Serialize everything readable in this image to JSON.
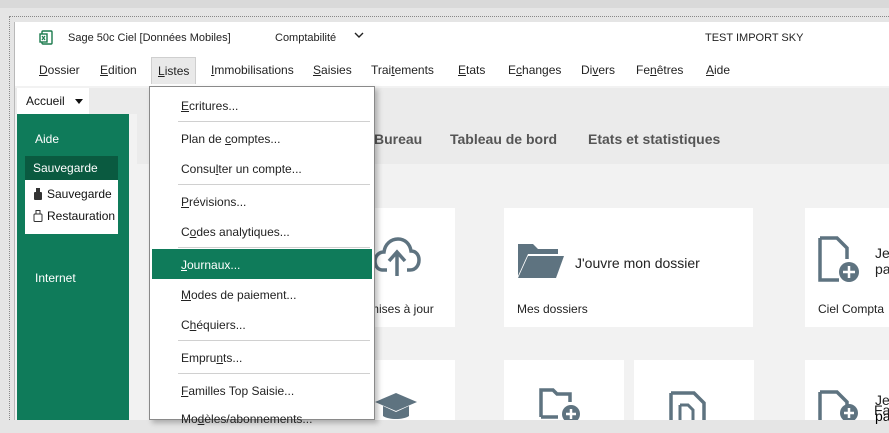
{
  "window": {
    "app_title": "Sage 50c Ciel [Données Mobiles]",
    "module": "Comptabilité",
    "company": "TEST IMPORT SKY"
  },
  "menubar": {
    "items": [
      {
        "pre": "",
        "key": "D",
        "post": "ossier"
      },
      {
        "pre": "",
        "key": "E",
        "post": "dition"
      },
      {
        "pre": "",
        "key": "L",
        "post": "istes"
      },
      {
        "pre": "",
        "key": "I",
        "post": "mmobilisations"
      },
      {
        "pre": "",
        "key": "S",
        "post": "aisies"
      },
      {
        "pre": "Trai",
        "key": "t",
        "post": "ements"
      },
      {
        "pre": "",
        "key": "E",
        "post": "tats"
      },
      {
        "pre": "E",
        "key": "c",
        "post": "hanges"
      },
      {
        "pre": "Di",
        "key": "v",
        "post": "ers"
      },
      {
        "pre": "Fe",
        "key": "n",
        "post": "êtres"
      },
      {
        "pre": "",
        "key": "A",
        "post": "ide"
      }
    ]
  },
  "accueil": {
    "label": "Accueil"
  },
  "sidebar": {
    "aide": "Aide",
    "sauvegarde": "Sauvegarde",
    "sub": [
      "Sauvegarde",
      "Restauration"
    ],
    "internet": "Internet"
  },
  "tabs": [
    "Bureau",
    "Tableau de bord",
    "Etats et statistiques"
  ],
  "cards": {
    "updates_label": "mises à jour",
    "open_folder_title": "J'ouvre mon dossier",
    "open_folder_label": "Mes dossiers",
    "new_title_1": "Je",
    "new_title_2": "pa",
    "new_label": "Ciel Compta",
    "bottom_title_1": "Je",
    "bottom_title_2": "pa",
    "bottom_title_3": "Fa"
  },
  "dropdown": {
    "items": [
      {
        "pre": "",
        "key": "E",
        "post": "critures..."
      },
      {
        "pre": "Plan de ",
        "key": "c",
        "post": "omptes..."
      },
      {
        "pre": "Consu",
        "key": "l",
        "post": "ter un compte..."
      },
      {
        "pre": "",
        "key": "P",
        "post": "révisions..."
      },
      {
        "pre": "C",
        "key": "o",
        "post": "des analytiques..."
      },
      {
        "pre": "",
        "key": "J",
        "post": "ournaux..."
      },
      {
        "pre": "",
        "key": "M",
        "post": "odes de paiement..."
      },
      {
        "pre": "C",
        "key": "h",
        "post": "équiers..."
      },
      {
        "pre": "Empru",
        "key": "n",
        "post": "ts..."
      },
      {
        "pre": "",
        "key": "F",
        "post": "amilles Top Saisie..."
      },
      {
        "pre": "Mo",
        "key": "d",
        "post": "èles/abonnements..."
      }
    ]
  },
  "colors": {
    "accent": "#0f7b5a",
    "accent_dark": "#0a5a40",
    "icon": "#5e7380"
  }
}
